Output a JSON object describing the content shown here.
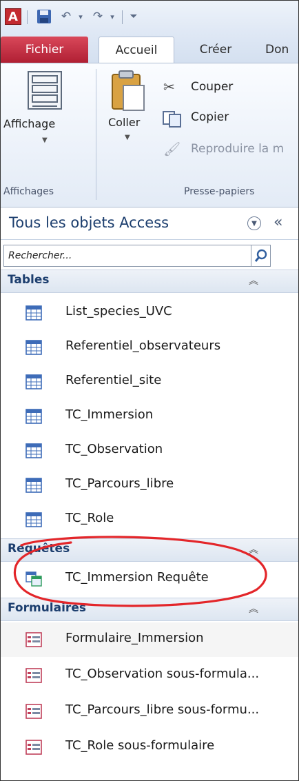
{
  "app": {
    "logo_letter": "A"
  },
  "tabs": [
    {
      "label": "Fichier"
    },
    {
      "label": "Accueil"
    },
    {
      "label": "Créer"
    },
    {
      "label": "Don"
    }
  ],
  "ribbon": {
    "affichage_label": "Affichage",
    "coller_label": "Coller",
    "couper_label": "Couper",
    "copier_label": "Copier",
    "reproduire_label": "Reproduire la m",
    "group_affichages": "Affichages",
    "group_presse_papiers": "Presse-papiers"
  },
  "nav": {
    "title": "Tous les objets Access",
    "collapse_glyph": "«",
    "search_placeholder": "Rechercher..."
  },
  "sections": [
    {
      "title": "Tables",
      "items": [
        {
          "label": "List_species_UVC"
        },
        {
          "label": "Referentiel_observateurs"
        },
        {
          "label": "Referentiel_site"
        },
        {
          "label": "TC_Immersion"
        },
        {
          "label": "TC_Observation"
        },
        {
          "label": "TC_Parcours_libre"
        },
        {
          "label": "TC_Role"
        }
      ]
    },
    {
      "title": "Requêtes",
      "items": [
        {
          "label": "TC_Immersion Requête"
        }
      ]
    },
    {
      "title": "Formulaires",
      "items": [
        {
          "label": "Formulaire_Immersion"
        },
        {
          "label": "TC_Observation sous-formula..."
        },
        {
          "label": "TC_Parcours_libre sous-formu..."
        },
        {
          "label": "TC_Role sous-formulaire"
        }
      ]
    }
  ],
  "colors": {
    "file_tab": "#c4283d",
    "header_text": "#1c3e6e",
    "annotation": "#e3262a"
  }
}
